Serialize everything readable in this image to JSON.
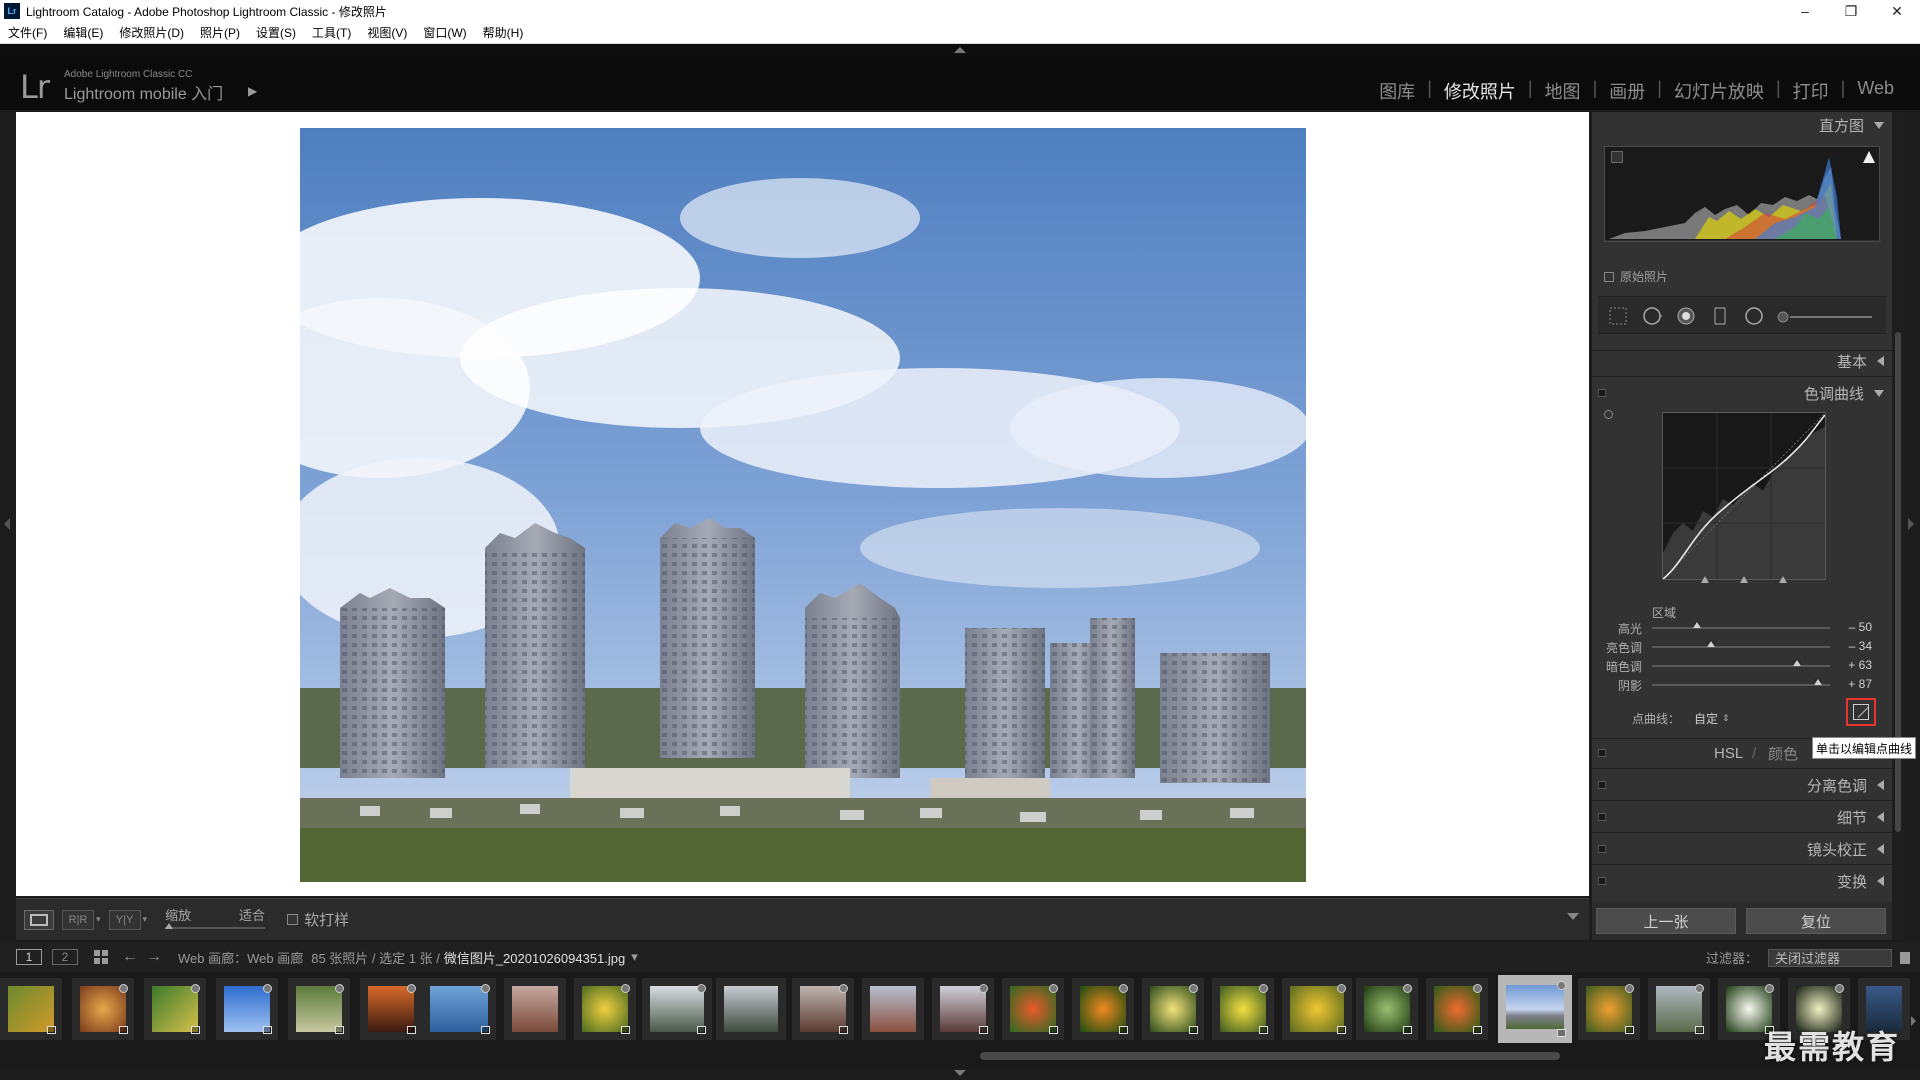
{
  "window": {
    "title": "Lightroom Catalog - Adobe Photoshop Lightroom Classic - 修改照片",
    "app_icon": "Lr",
    "minimize": "–",
    "restore": "❐",
    "close": "✕"
  },
  "menu": [
    "文件(F)",
    "编辑(E)",
    "修改照片(D)",
    "照片(P)",
    "设置(S)",
    "工具(T)",
    "视图(V)",
    "窗口(W)",
    "帮助(H)"
  ],
  "identity": {
    "logo": "Lr",
    "product": "Adobe Lightroom Classic CC",
    "mobile": "Lightroom mobile 入门",
    "arrow": "▶"
  },
  "modules": [
    {
      "label": "图库",
      "active": false
    },
    {
      "label": "修改照片",
      "active": true
    },
    {
      "label": "地图",
      "active": false
    },
    {
      "label": "画册",
      "active": false
    },
    {
      "label": "幻灯片放映",
      "active": false
    },
    {
      "label": "打印",
      "active": false
    },
    {
      "label": "Web",
      "active": false
    }
  ],
  "toolbar": {
    "view_compare": "R|R",
    "view_yy": "Y|Y",
    "zoom_label": "缩放",
    "zoom_fit": "适合",
    "soft_proof": "软打样"
  },
  "right_panel": {
    "histogram_title": "直方图",
    "original_photo": "原始照片",
    "basic_title": "基本",
    "tone_curve_title": "色调曲线",
    "region_label": "区域",
    "sliders": [
      {
        "label": "高光",
        "value": "– 50",
        "pos": -50
      },
      {
        "label": "亮色调",
        "value": "– 34",
        "pos": -34
      },
      {
        "label": "暗色调",
        "value": "+ 63",
        "pos": 63
      },
      {
        "label": "阴影",
        "value": "+ 87",
        "pos": 87
      }
    ],
    "point_curve_label": "点曲线：",
    "point_curve_value": "自定",
    "tooltip": "单击以编辑点曲线",
    "hsl": "HSL",
    "hsl_sep": "/",
    "color": "颜色",
    "split_toning": "分离色调",
    "detail": "细节",
    "lens_correction": "镜头校正",
    "transform": "变换",
    "prev_button": "上一张",
    "reset_button": "复位"
  },
  "filmstrip": {
    "page1": "1",
    "page2": "2",
    "nav_back": "←",
    "nav_forward": "→",
    "source": "Web 画廊：Web 画廊",
    "count": "85 张照片 / 选定 1 张 /",
    "filename": "微信图片_20201026094351.jpg",
    "filename_caret": "▾",
    "filter_label": "过滤器：",
    "filter_value": "关闭过滤器"
  },
  "watermark": "最需教育",
  "colors": {
    "accent_red": "#e8342f",
    "active_module": "#e6e6e6",
    "panel_bg": "#323232"
  }
}
